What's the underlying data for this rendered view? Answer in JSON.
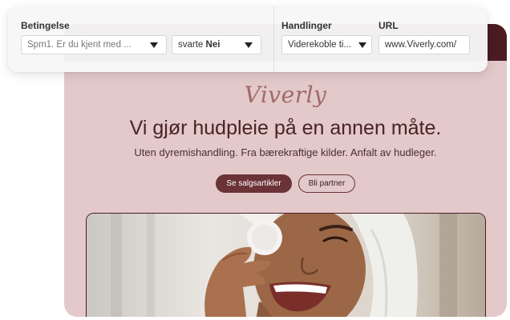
{
  "panel": {
    "condition_heading": "Betingelse",
    "actions_heading": "Handlinger",
    "url_heading": "URL",
    "question_select": "Spm1. Er du kjent med ...",
    "answer_prefix": "svarte",
    "answer_value": "Nei",
    "action_select": "Viderekoble ti...",
    "url_value": "www.Viverly.com/"
  },
  "site": {
    "logo": "Viverly",
    "headline": "Vi gjør hudpleie på en annen måte.",
    "subline": "Uten dyremishandling. Fra bærekraftige kilder. Anfalt av hudleger.",
    "primary_button": "Se salgsartikler",
    "secondary_button": "Bli partner"
  },
  "colors": {
    "brand_dark": "#4a1c22",
    "brand_bg": "#e3c9c9",
    "button_primary": "#6b3337"
  }
}
